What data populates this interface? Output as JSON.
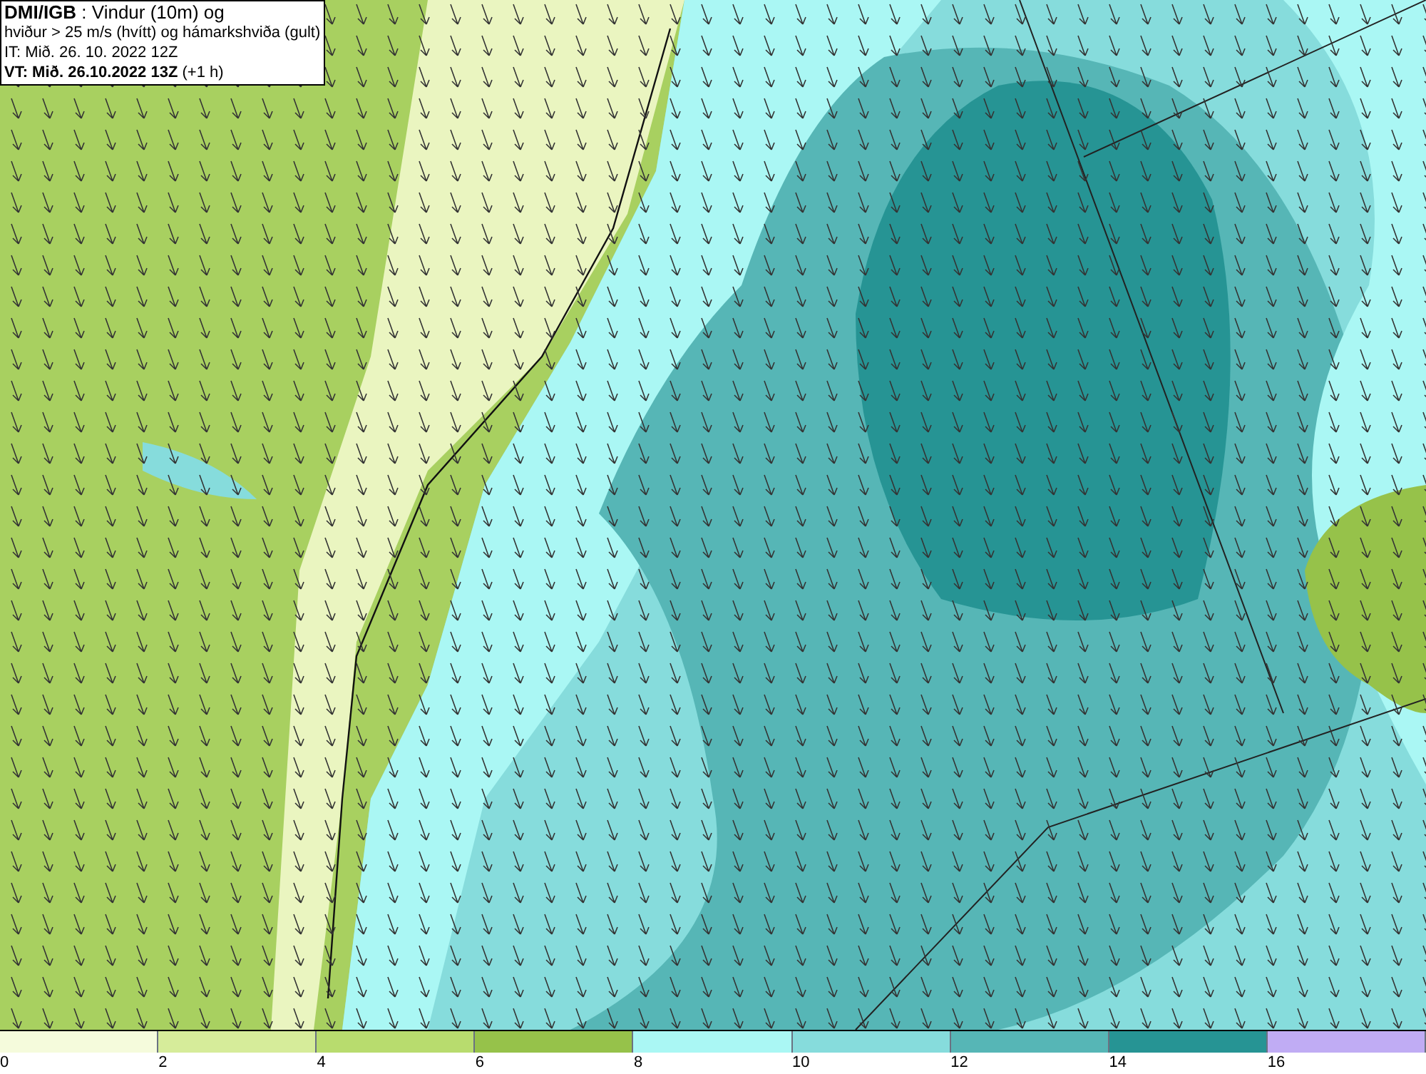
{
  "header": {
    "lines": [
      "**DMI/IGB** : Vindur (10m) og",
      "hviður > 25 m/s (hvítt) og hámarkshviða (gult)",
      "IT: Mið. 26. 10. 2022 12Z",
      "**VT: Mið. 26.10.2022 13Z** (+1 h)"
    ]
  },
  "legend": {
    "segments": [
      {
        "label": "0",
        "color": "#f5fbdc"
      },
      {
        "label": "2",
        "color": "#d6ec9a"
      },
      {
        "label": "4",
        "color": "#b8dc6e"
      },
      {
        "label": "6",
        "color": "#96c24a"
      },
      {
        "label": "8",
        "color": "#aaf7f4"
      },
      {
        "label": "10",
        "color": "#86dcdc"
      },
      {
        "label": "12",
        "color": "#56b6b6"
      },
      {
        "label": "14",
        "color": "#269494"
      },
      {
        "label": "16",
        "color": "#c0acf4"
      }
    ]
  }
}
